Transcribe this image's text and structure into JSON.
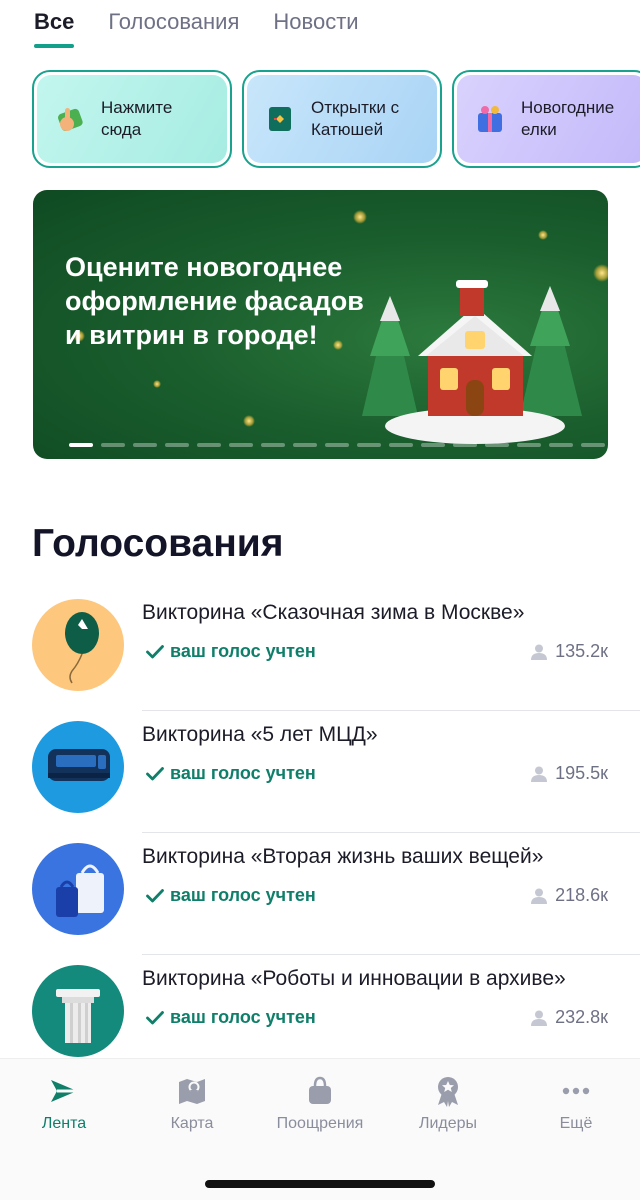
{
  "tabs": [
    {
      "label": "Все",
      "active": true
    },
    {
      "label": "Голосования",
      "active": false
    },
    {
      "label": "Новости",
      "active": false
    }
  ],
  "chips": [
    {
      "label": "Нажмите\nсюда",
      "icon": "pointing-hand-icon",
      "bg": "#b2f1e8"
    },
    {
      "label": "Открытки с\nКатюшей",
      "icon": "postcard-icon",
      "bg": "#b7dcf7"
    },
    {
      "label": "Новогодние\nелки",
      "icon": "gift-icon",
      "bg": "#cfc7fb"
    }
  ],
  "banner": {
    "title": "Оцените новогоднее\nоформление фасадов\nи витрин в городе!",
    "slide_count": 17,
    "active_slide": 0
  },
  "section": {
    "title": "Голосования"
  },
  "votes": [
    {
      "title": "Викторина «Сказочная зима в Москве»",
      "status": "ваш голос учтен",
      "count": "135.2к",
      "avatar": "balloon-icon",
      "avatar_bg": "#fdc77e"
    },
    {
      "title": "Викторина «5 лет МЦД»",
      "status": "ваш голос учтен",
      "count": "195.5к",
      "avatar": "train-icon",
      "avatar_bg": "#1e9be0"
    },
    {
      "title": "Викторина «Вторая жизнь ваших вещей»",
      "status": "ваш голос учтен",
      "count": "218.6к",
      "avatar": "shopping-bags-icon",
      "avatar_bg": "#3a74e0"
    },
    {
      "title": "Викторина «Роботы и инновации в архиве»",
      "status": "ваш голос учтен",
      "count": "232.8к",
      "avatar": "column-icon",
      "avatar_bg": "#138a7c"
    }
  ],
  "nav": [
    {
      "label": "Лента",
      "icon": "feed-logo-icon",
      "active": true
    },
    {
      "label": "Карта",
      "icon": "map-icon",
      "active": false
    },
    {
      "label": "Поощрения",
      "icon": "shopping-bag-icon",
      "active": false
    },
    {
      "label": "Лидеры",
      "icon": "medal-icon",
      "active": false
    },
    {
      "label": "Ещё",
      "icon": "more-dots-icon",
      "active": false
    }
  ],
  "colors": {
    "accent": "#13a08a",
    "voted_text": "#0f7f6a",
    "banner_bg": "#1b5f2e"
  }
}
